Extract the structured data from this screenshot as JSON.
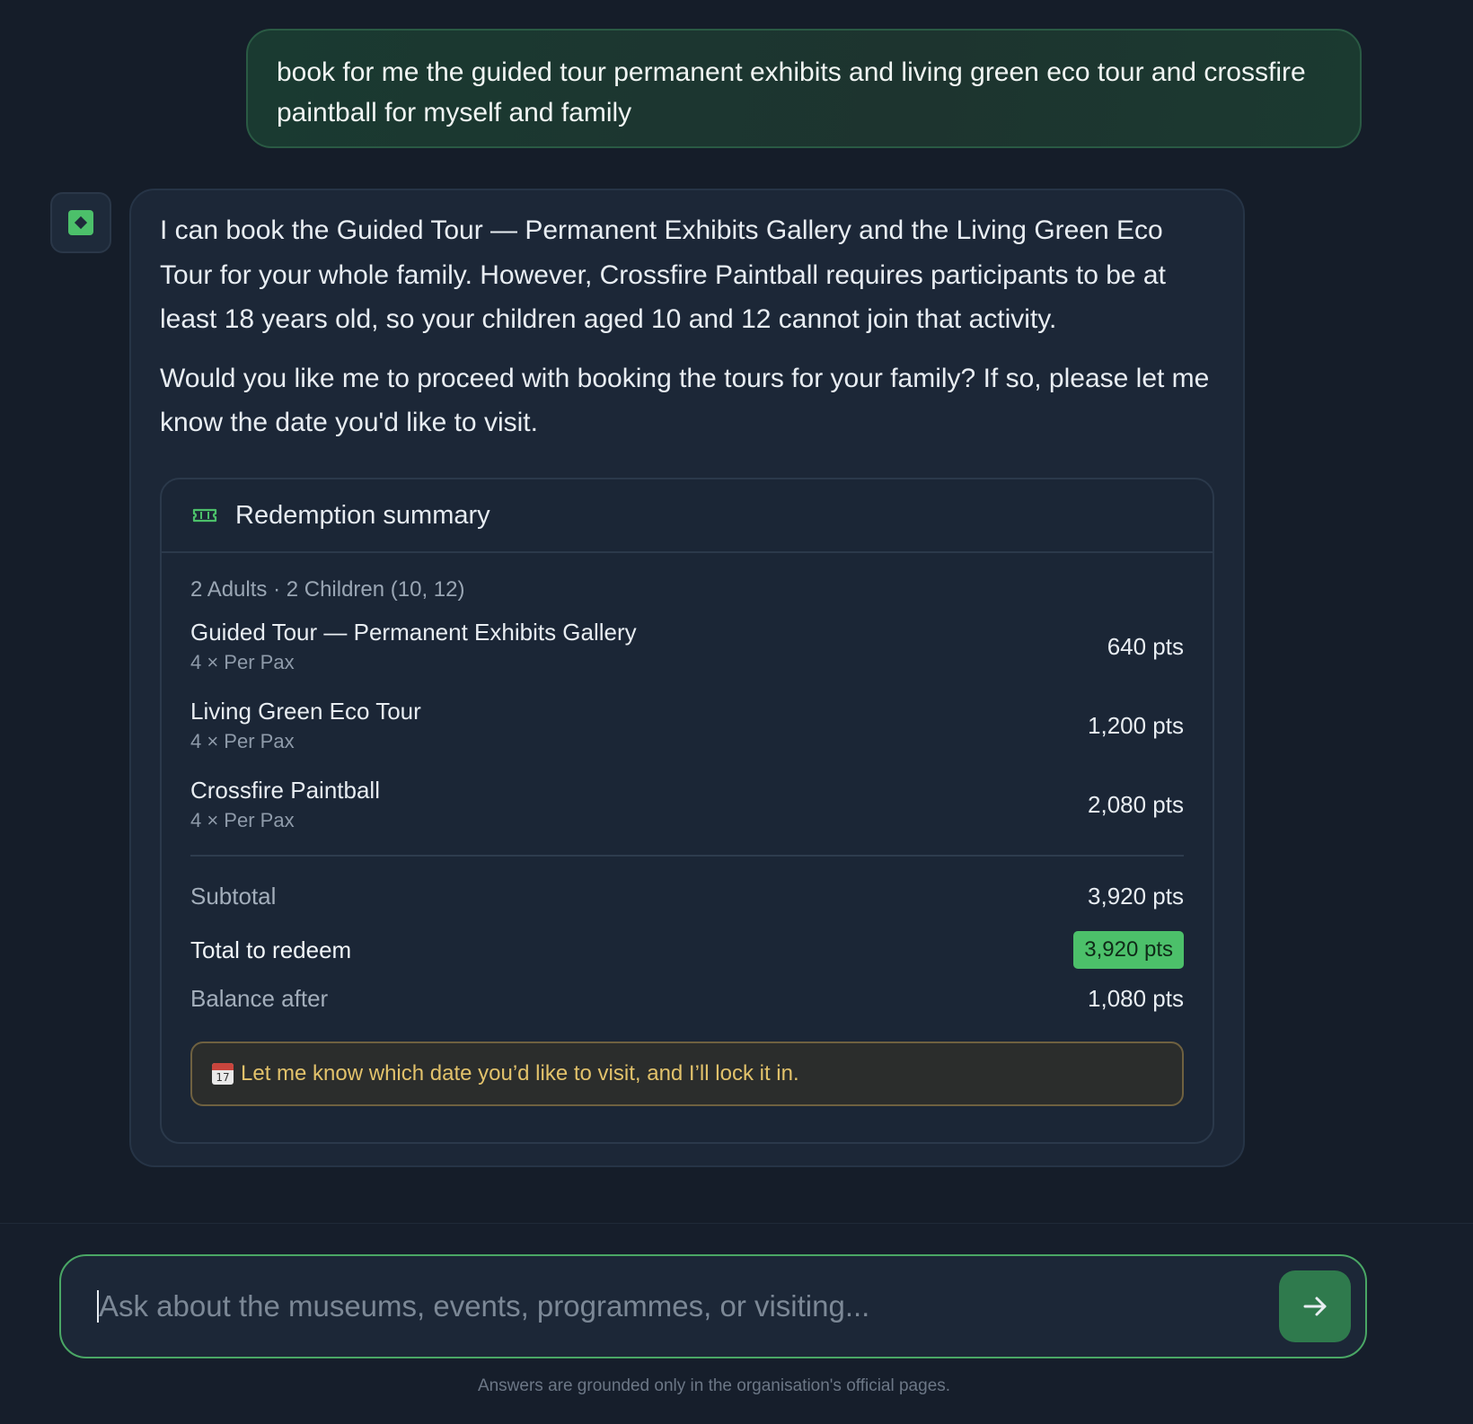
{
  "user_message": "book for me the guided tour permanent exhibits and living green eco tour and crossfire paintball for myself and family",
  "assistant": {
    "paragraph1": "I can book the Guided Tour — Permanent Exhibits Gallery and the Living Green Eco Tour for your whole family. However, Crossfire Paintball requires participants to be at least 18 years old, so your children aged 10 and 12 cannot join that activity.",
    "paragraph2": "Would you like me to proceed with booking the tours for your family? If so, please let me know the date you'd like to visit."
  },
  "summary": {
    "title": "Redemption summary",
    "party": "2 Adults · 2 Children (10, 12)",
    "items": [
      {
        "name": "Guided Tour — Permanent Exhibits Gallery",
        "qty": "4 × Per Pax",
        "pts": "640 pts"
      },
      {
        "name": "Living Green Eco Tour",
        "qty": "4 × Per Pax",
        "pts": "1,200 pts"
      },
      {
        "name": "Crossfire Paintball",
        "qty": "4 × Per Pax",
        "pts": "2,080 pts"
      }
    ],
    "subtotal_label": "Subtotal",
    "subtotal_value": "3,920 pts",
    "total_label": "Total to redeem",
    "total_value": "3,920 pts",
    "balance_label": "Balance after",
    "balance_value": "1,080 pts",
    "notice_icon": "calendar-icon",
    "calendar_day": "17",
    "notice": "Let me know which date you’d like to visit, and I’ll lock it in."
  },
  "composer": {
    "placeholder": "Ask about the museums, events, programmes, or visiting...",
    "value": ""
  },
  "disclaimer": "Answers are grounded only in the organisation's official pages.",
  "colors": {
    "accent": "#4cc06a",
    "background": "#151d29",
    "notice_text": "#e2c26b"
  }
}
